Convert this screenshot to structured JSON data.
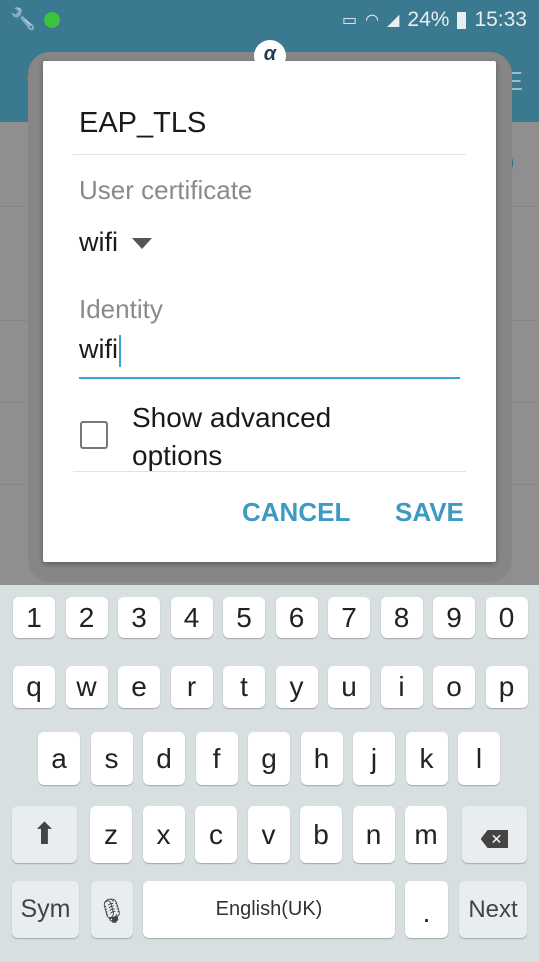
{
  "status": {
    "battery": "24%",
    "time": "15:33",
    "icons": [
      "wrench-icon",
      "vnc-icon",
      "cast-icon",
      "wifi-icon",
      "signal-icon",
      "battery-charging-icon"
    ]
  },
  "appbar": {
    "more_partial": "RE"
  },
  "dialog": {
    "title": "EAP_TLS",
    "cert_label": "User certificate",
    "cert_value": "wifi",
    "identity_label": "Identity",
    "identity_value": "wifi",
    "advanced_label": "Show advanced options",
    "advanced_checked": false,
    "cancel": "CANCEL",
    "save": "SAVE",
    "accent": "#3d9ac0"
  },
  "keyboard": {
    "rows": [
      [
        "1",
        "2",
        "3",
        "4",
        "5",
        "6",
        "7",
        "8",
        "9",
        "0"
      ],
      [
        "q",
        "w",
        "e",
        "r",
        "t",
        "y",
        "u",
        "i",
        "o",
        "p"
      ],
      [
        "a",
        "s",
        "d",
        "f",
        "g",
        "h",
        "j",
        "k",
        "l"
      ],
      [
        "z",
        "x",
        "c",
        "v",
        "b",
        "n",
        "m"
      ]
    ],
    "sym": "Sym",
    "space": "English(UK)",
    "period": ".",
    "next": "Next"
  }
}
